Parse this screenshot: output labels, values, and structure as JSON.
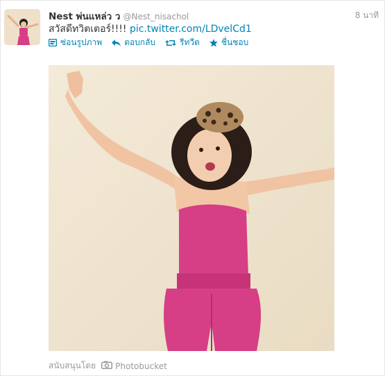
{
  "tweet": {
    "display_name": "Nest พ่นแหล่ว ว",
    "handle": "@Nest_nisachol",
    "timestamp": "8 นาที",
    "text": "สวัสดีทวิตเตอร์!!!!",
    "link": "pic.twitter.com/LDvelCd1"
  },
  "actions": {
    "hide_photo": "ซ่อนรูปภาพ",
    "reply": "ตอบกลับ",
    "retweet": "รีทวีต",
    "favorite": "ชื่นชอบ"
  },
  "footer": {
    "sponsored_label": "สนับสนุนโดย",
    "provider": "Photobucket"
  },
  "colors": {
    "link_blue": "#0084b4",
    "muted_gray": "#999999",
    "outfit_pink": "#d63e86"
  }
}
